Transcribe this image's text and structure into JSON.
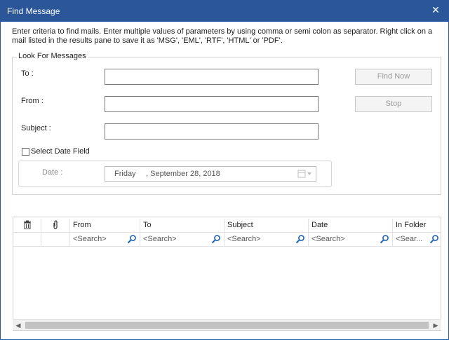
{
  "window": {
    "title": "Find Message"
  },
  "description": "Enter criteria to find mails. Enter multiple values of parameters by using comma or semi colon as separator. Right click on a mail listed in the results pane to save it as 'MSG', 'EML', 'RTF', 'HTML' or 'PDF'.",
  "group": {
    "legend": "Look For Messages",
    "to_label": "To :",
    "from_label": "From :",
    "subject_label": "Subject :",
    "to_value": "",
    "from_value": "",
    "subject_value": "",
    "find_now_label": "Find Now",
    "stop_label": "Stop"
  },
  "date": {
    "checkbox_label": "Select Date Field",
    "checked": false,
    "label": "Date :",
    "day": "Friday",
    "rest": ", September 28, 2018"
  },
  "grid": {
    "columns": [
      "From",
      "To",
      "Subject",
      "Date",
      "In Folder"
    ],
    "search_placeholders": [
      "<Search>",
      "<Search>",
      "<Search>",
      "<Search>",
      "<Sear..."
    ]
  },
  "colors": {
    "titlebar": "#2b579a",
    "search_icon": "#1f63b5"
  }
}
